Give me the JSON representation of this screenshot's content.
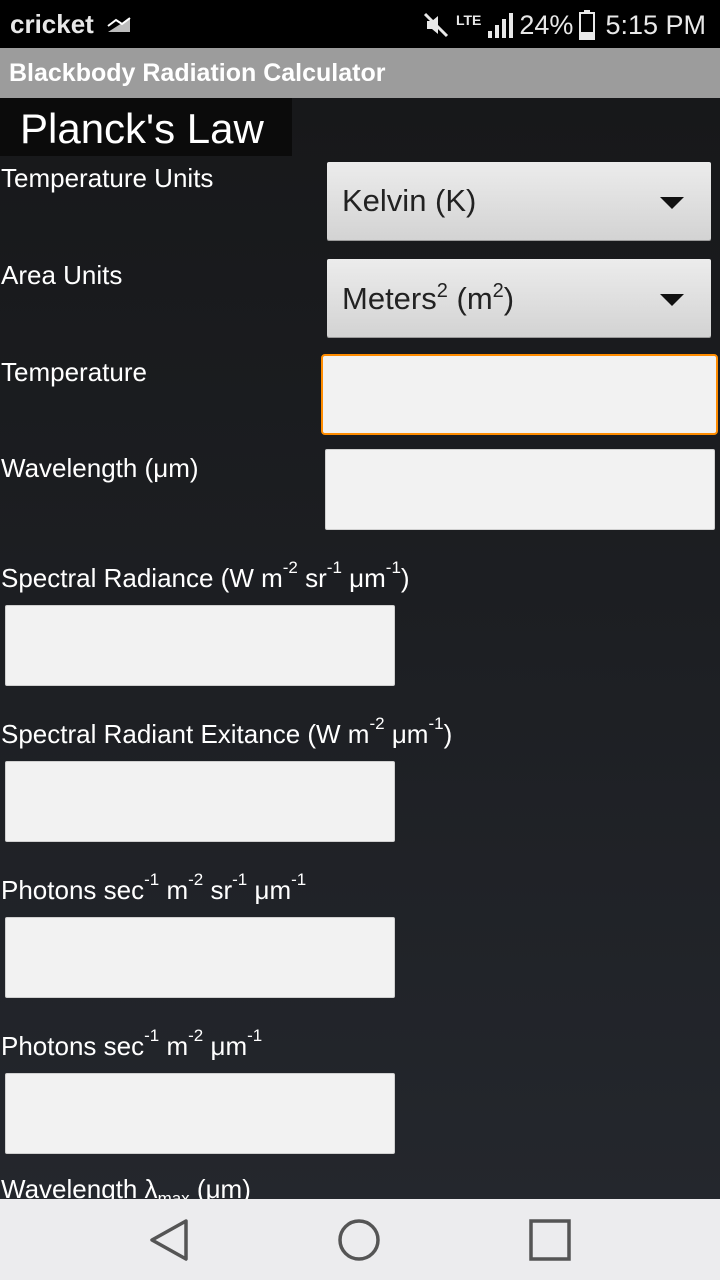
{
  "status_bar": {
    "carrier": "cricket",
    "network": "LTE",
    "battery": "24%",
    "time": "5:15 PM",
    "icons": [
      "signal-triangle-icon",
      "mute-icon",
      "lte-icon",
      "cell-signal-icon",
      "battery-icon"
    ]
  },
  "app_bar": {
    "title": "Blackbody Radiation Calculator"
  },
  "section": {
    "title": "Planck's Law"
  },
  "temperature_units": {
    "label": "Temperature Units",
    "value": "Kelvin (K)"
  },
  "area_units": {
    "label": "Area Units",
    "value_base": "Meters",
    "value_exp": "2",
    "value_open": "(m",
    "value_exp2": "2",
    "value_close": ")"
  },
  "temperature": {
    "label": "Temperature",
    "value": ""
  },
  "wavelength": {
    "label": "Wavelength (μm)",
    "value": ""
  },
  "spectral_radiance": {
    "label_parts": [
      "Spectral Radiance (W m",
      "-2",
      " sr",
      "-1",
      " μm",
      "-1",
      ")"
    ],
    "value": ""
  },
  "spectral_exitance": {
    "label_parts": [
      "Spectral Radiant Exitance (W m",
      "-2",
      " μm",
      "-1",
      ")"
    ],
    "value": ""
  },
  "photons_sr": {
    "label_parts": [
      "Photons sec",
      "-1",
      " m",
      "-2",
      " sr",
      "-1",
      " μm",
      "-1"
    ],
    "value": ""
  },
  "photons": {
    "label_parts": [
      "Photons sec",
      "-1",
      " m",
      "-2",
      " μm",
      "-1"
    ],
    "value": ""
  },
  "wavelength_max": {
    "label_parts": [
      "Wavelength λ",
      "max",
      " (μm)"
    ]
  },
  "nav_bar": {
    "icons": [
      "back-icon",
      "home-icon",
      "recents-icon"
    ]
  },
  "colors": {
    "focus": "#ff8c00",
    "app_bar": "#9c9c9c",
    "background": "#1a1b1f"
  }
}
